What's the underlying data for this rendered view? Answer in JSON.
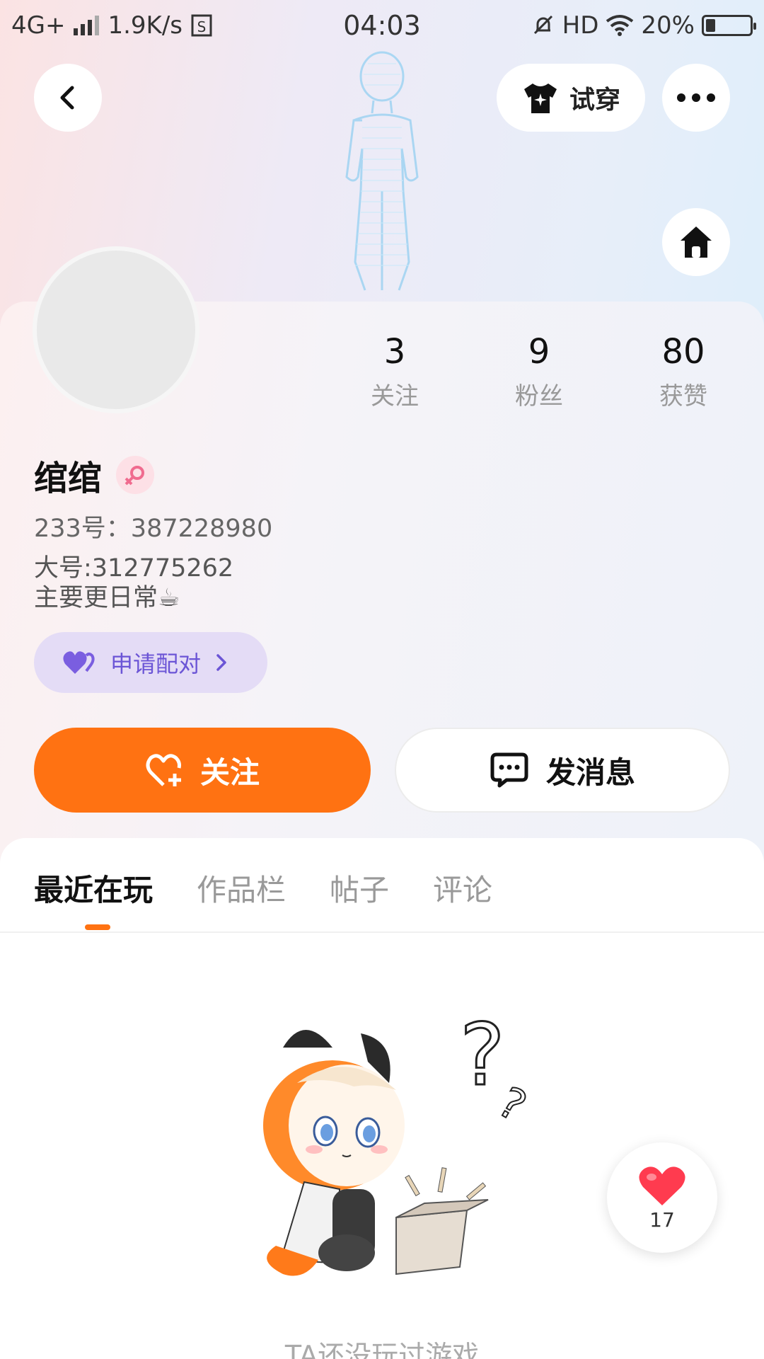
{
  "status_bar": {
    "network": "4G+",
    "speed": "1.9K/s",
    "time": "04:03",
    "hd": "HD",
    "battery": "20%",
    "battery_level": 0.2
  },
  "header": {
    "tryon_label": "试穿"
  },
  "stats": [
    {
      "num": "3",
      "label": "关注"
    },
    {
      "num": "9",
      "label": "粉丝"
    },
    {
      "num": "80",
      "label": "获赞"
    }
  ],
  "profile": {
    "name": "绾绾",
    "id_line": "233号：387228980",
    "bio_line1": "大号:312775262",
    "bio_line2": "主要更日常☕"
  },
  "actions": {
    "pair_label": "申请配对",
    "follow_label": "关注",
    "message_label": "发消息"
  },
  "tabs": [
    "最近在玩",
    "作品栏",
    "帖子",
    "评论"
  ],
  "empty": {
    "text": "TA还没玩过游戏"
  },
  "like_button": {
    "count": "17"
  },
  "colors": {
    "accent": "#ff7212",
    "pair_text": "#6b55d6",
    "pair_bg": "#e4dcf6"
  }
}
